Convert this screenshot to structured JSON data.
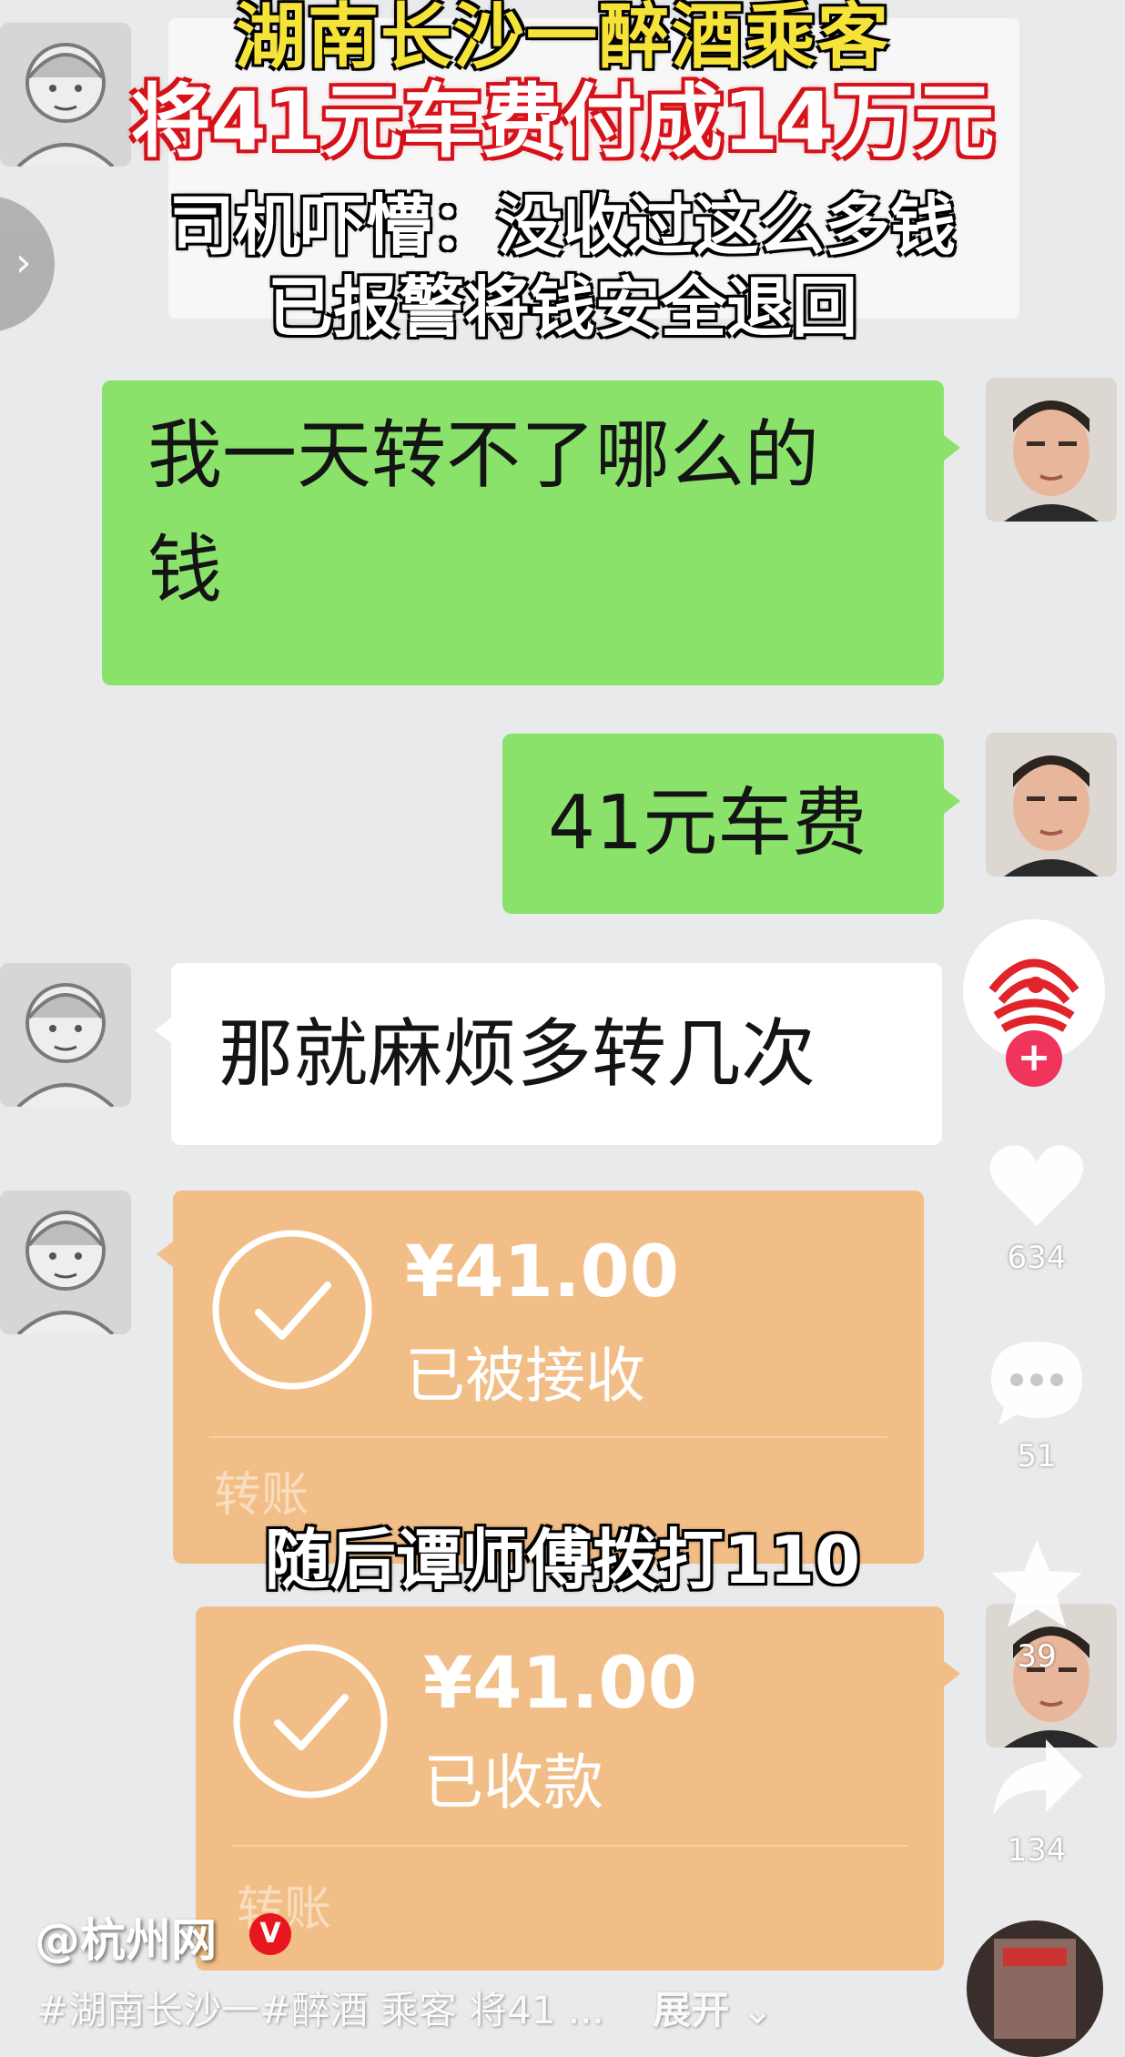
{
  "headline": {
    "line1": "湖南长沙一醉酒乘客",
    "line2": "将41元车费付成14万元",
    "line3": "司机吓懵：没收过这么多钱",
    "line4": "已报警将钱安全退回"
  },
  "chat": {
    "messages": [
      {
        "sender": "user",
        "text_line1": "我一天转不了哪么的",
        "text_line2": "钱"
      },
      {
        "sender": "user",
        "text": "41元车费"
      },
      {
        "sender": "driver",
        "text": "那就麻烦多转几次"
      }
    ],
    "transfers": [
      {
        "sender": "driver",
        "amount": "¥41.00",
        "status": "已被接收",
        "label": "转账"
      },
      {
        "sender": "user",
        "amount": "¥41.00",
        "status": "已收款",
        "label": "转账"
      }
    ]
  },
  "caption": "随后谭师傅拨打110",
  "rail": {
    "follow_icon": "plus-icon",
    "likes": "634",
    "comments": "51",
    "favorites": "39",
    "shares": "134"
  },
  "footer": {
    "account": "@杭州网",
    "verified_mark": "V",
    "hashtags": "#湖南长沙一#醉酒 乘客   将41 ...",
    "expand": "展开"
  },
  "colors": {
    "green_bubble": "#8be26b",
    "transfer_card": "#f2be87",
    "headline_yellow": "#f6e33a",
    "headline_red": "#d0121a",
    "accent_pink": "#f0345c"
  }
}
